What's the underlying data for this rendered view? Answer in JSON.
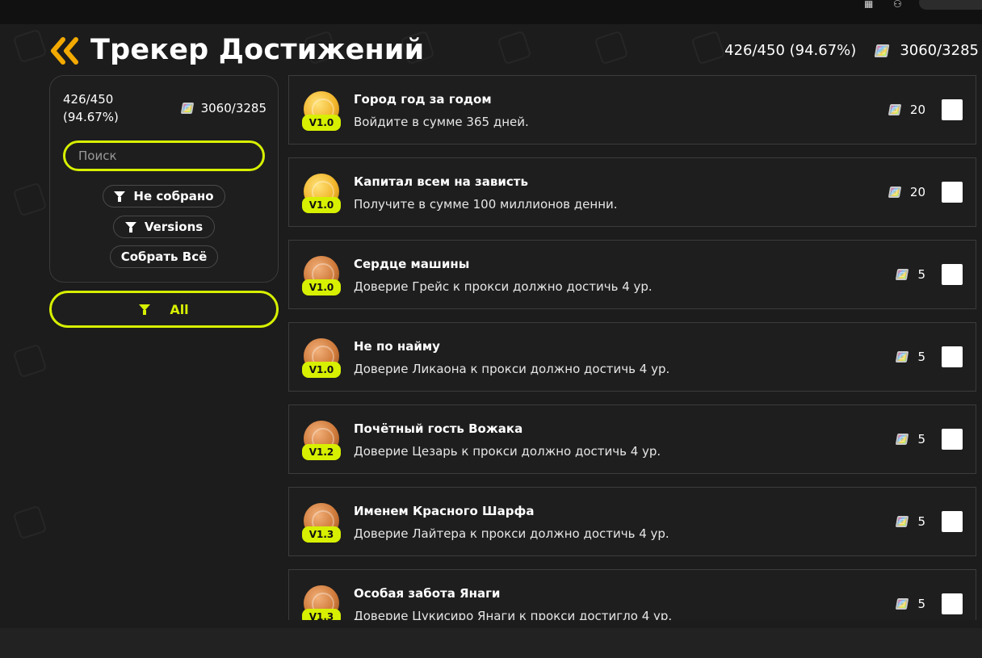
{
  "header": {
    "title": "Трекер Достижений",
    "progress": "426/450 (94.67%)",
    "points": "3060/3285"
  },
  "sidebar": {
    "progress_count": "426/450",
    "progress_percent": "(94.67%)",
    "points": "3060/3285",
    "search_placeholder": "Поиск",
    "filter_uncollected": "Не собрано",
    "filter_versions": "Versions",
    "collect_all": "Собрать Всё",
    "all_label": "All"
  },
  "colors": {
    "accent": "#d7f000",
    "back_arrow": "#f2a900"
  },
  "achievements": [
    {
      "title": "Город год за годом",
      "desc": "Войдите в сумме 365 дней.",
      "version": "V1.0",
      "reward": "20",
      "medal": "gold"
    },
    {
      "title": "Капитал всем на зависть",
      "desc": "Получите в сумме 100 миллионов денни.",
      "version": "V1.0",
      "reward": "20",
      "medal": "gold"
    },
    {
      "title": "Сердце машины",
      "desc": "Доверие Грейс к прокси должно достичь 4 ур.",
      "version": "V1.0",
      "reward": "5",
      "medal": "bronze"
    },
    {
      "title": "Не по найму",
      "desc": "Доверие Ликаона к прокси должно достичь 4 ур.",
      "version": "V1.0",
      "reward": "5",
      "medal": "bronze"
    },
    {
      "title": "Почётный гость Вожака",
      "desc": "Доверие Цезарь к прокси должно достичь 4 ур.",
      "version": "V1.2",
      "reward": "5",
      "medal": "bronze"
    },
    {
      "title": "Именем Красного Шарфа",
      "desc": "Доверие Лайтера к прокси должно достичь 4 ур.",
      "version": "V1.3",
      "reward": "5",
      "medal": "bronze"
    },
    {
      "title": "Особая забота Янаги",
      "desc": "Доверие Цукисиро Янаги к прокси достигло 4 ур.",
      "version": "V1.3",
      "reward": "5",
      "medal": "bronze"
    }
  ]
}
